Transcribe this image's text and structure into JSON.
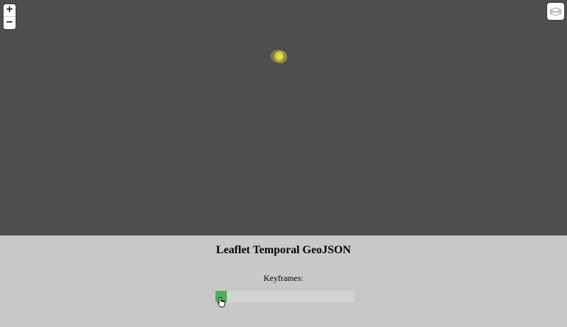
{
  "map": {
    "zoom_in_label": "+",
    "zoom_out_label": "−",
    "layers_icon": "layers-icon",
    "feature_color": "#e6dc32",
    "background_color": "#4e4e4e"
  },
  "panel": {
    "title": "Leaflet Temporal GeoJSON",
    "keyframes_label": "Keyframes:",
    "slider_fill_color": "#4caf50",
    "slider_track_color": "#d3d3d3",
    "slider_value": 0
  }
}
